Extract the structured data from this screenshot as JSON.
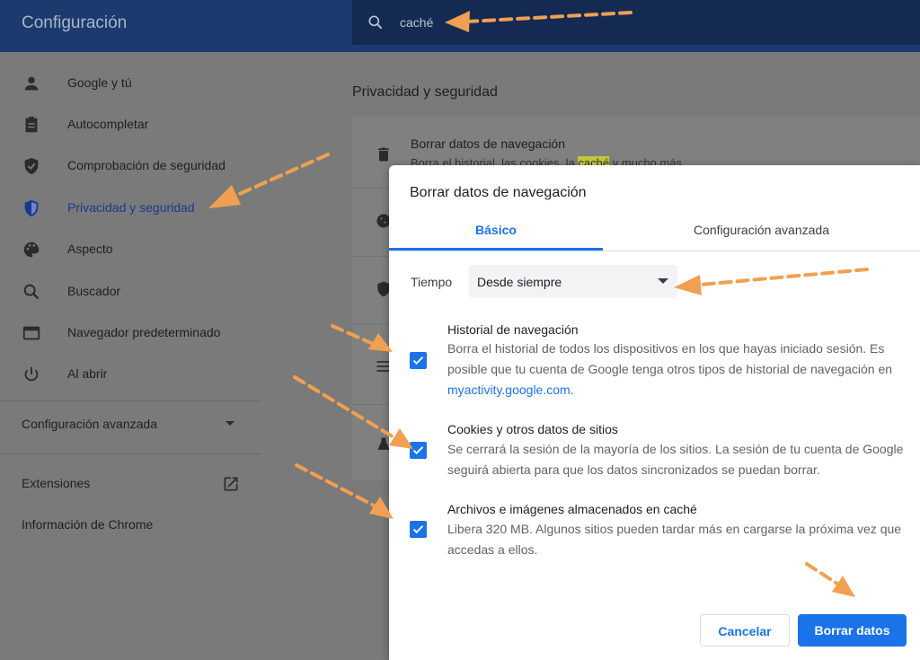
{
  "header": {
    "title": "Configuración",
    "search_value": "caché"
  },
  "sidebar": {
    "items": [
      {
        "label": "Google y tú",
        "icon": "person-icon"
      },
      {
        "label": "Autocompletar",
        "icon": "clipboard-icon"
      },
      {
        "label": "Comprobación de seguridad",
        "icon": "shield-check-icon"
      },
      {
        "label": "Privacidad y seguridad",
        "icon": "shield-icon",
        "active": true
      },
      {
        "label": "Aspecto",
        "icon": "palette-icon"
      },
      {
        "label": "Buscador",
        "icon": "search-icon"
      },
      {
        "label": "Navegador predeterminado",
        "icon": "browser-icon"
      },
      {
        "label": "Al abrir",
        "icon": "power-icon"
      }
    ],
    "advanced_label": "Configuración avanzada",
    "extensions_label": "Extensiones",
    "about_label": "Información de Chrome"
  },
  "main": {
    "section_title": "Privacidad y seguridad",
    "card_title": "Borrar datos de navegación",
    "card_desc_before": "Borra el historial, las cookies, la ",
    "card_desc_highlight": "caché",
    "card_desc_after": " y mucho más"
  },
  "dialog": {
    "title": "Borrar datos de navegación",
    "tabs": [
      "Básico",
      "Configuración avanzada"
    ],
    "time_label": "Tiempo",
    "time_value": "Desde siempre",
    "options": [
      {
        "title": "Historial de navegación",
        "desc": "Borra el historial de todos los dispositivos en los que hayas iniciado sesión. Es posible que tu cuenta de Google tenga otros tipos de historial de navegación en ",
        "link": "myactivity.google.com",
        "desc_end": ".",
        "checked": true
      },
      {
        "title": "Cookies y otros datos de sitios",
        "desc": "Se cerrará la sesión de la mayoría de los sitios. La sesión de tu cuenta de Google seguirá abierta para que los datos sincronizados se puedan borrar.",
        "checked": true
      },
      {
        "title": "Archivos e imágenes almacenados en caché",
        "desc": "Libera 320 MB. Algunos sitios pueden tardar más en cargarse la próxima vez que accedas a ellos.",
        "checked": true
      }
    ],
    "cancel_label": "Cancelar",
    "confirm_label": "Borrar datos"
  },
  "colors": {
    "accent": "#1a73e8",
    "header": "#1c3a6e",
    "annotation_arrow": "#f0a050"
  }
}
